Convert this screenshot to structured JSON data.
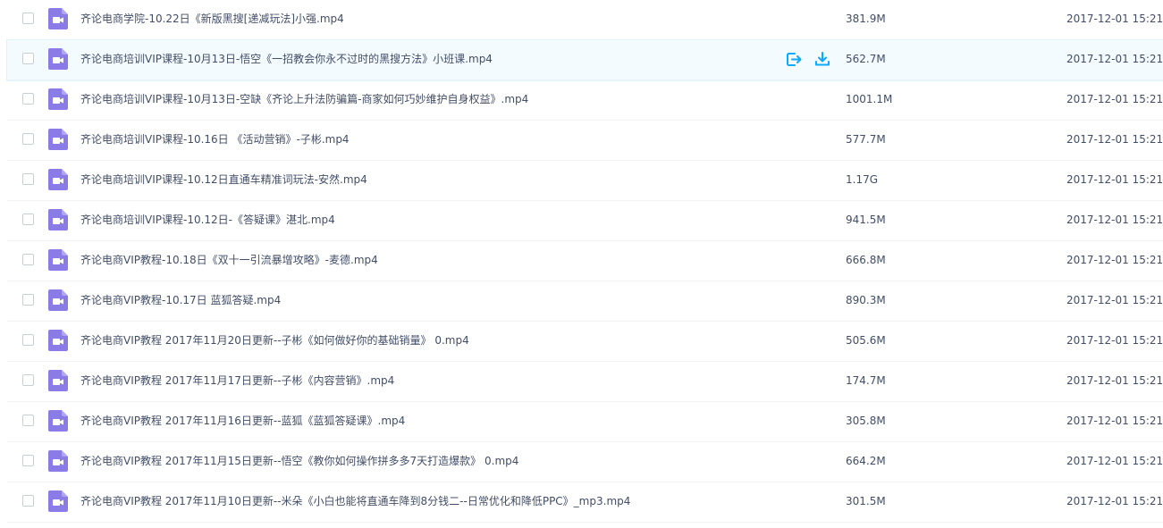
{
  "colors": {
    "icon_purple": "#8b7be6",
    "action_blue": "#09aaff",
    "hover_bg": "#f4fbff"
  },
  "files": [
    {
      "name": "齐论电商学院-10.22日《新版黑搜[递减玩法]小强.mp4",
      "size": "381.9M",
      "date": "2017-12-01 15:21"
    },
    {
      "name": "齐论电商培训VIP课程-10月13日-悟空《一招教会你永不过时的黑搜方法》小班课.mp4",
      "size": "562.7M",
      "date": "2017-12-01 15:21"
    },
    {
      "name": "齐论电商培训VIP课程-10月13日-空缺《齐论上升法防骗篇-商家如何巧妙维护自身权益》.mp4",
      "size": "1001.1M",
      "date": "2017-12-01 15:21"
    },
    {
      "name": "齐论电商培训VIP课程-10.16日 《活动营销》-子彬.mp4",
      "size": "577.7M",
      "date": "2017-12-01 15:21"
    },
    {
      "name": "齐论电商培训VIP课程-10.12日直通车精准词玩法-安然.mp4",
      "size": "1.17G",
      "date": "2017-12-01 15:21"
    },
    {
      "name": "齐论电商培训VIP课程-10.12日-《答疑课》湛北.mp4",
      "size": "941.5M",
      "date": "2017-12-01 15:21"
    },
    {
      "name": "齐论电商VIP教程-10.18日《双十一引流暴增攻略》-麦德.mp4",
      "size": "666.8M",
      "date": "2017-12-01 15:21"
    },
    {
      "name": "齐论电商VIP教程-10.17日 蓝狐答疑.mp4",
      "size": "890.3M",
      "date": "2017-12-01 15:21"
    },
    {
      "name": "齐论电商VIP教程 2017年11月20日更新--子彬《如何做好你的基础销量》 0.mp4",
      "size": "505.6M",
      "date": "2017-12-01 15:21"
    },
    {
      "name": "齐论电商VIP教程 2017年11月17日更新--子彬《内容营销》.mp4",
      "size": "174.7M",
      "date": "2017-12-01 15:21"
    },
    {
      "name": "齐论电商VIP教程 2017年11月16日更新--蓝狐《蓝狐答疑课》.mp4",
      "size": "305.8M",
      "date": "2017-12-01 15:21"
    },
    {
      "name": "齐论电商VIP教程 2017年11月15日更新--悟空《教你如何操作拼多多7天打造爆款》 0.mp4",
      "size": "664.2M",
      "date": "2017-12-01 15:21"
    },
    {
      "name": "齐论电商VIP教程 2017年11月10日更新--米朵《小白也能将直通车降到8分钱二--日常优化和降低PPC》_mp3.mp4",
      "size": "301.5M",
      "date": "2017-12-01 15:21"
    }
  ],
  "hovered_row": 1,
  "row_actions": [
    {
      "icon": "share-export-icon"
    },
    {
      "icon": "download-icon"
    }
  ]
}
